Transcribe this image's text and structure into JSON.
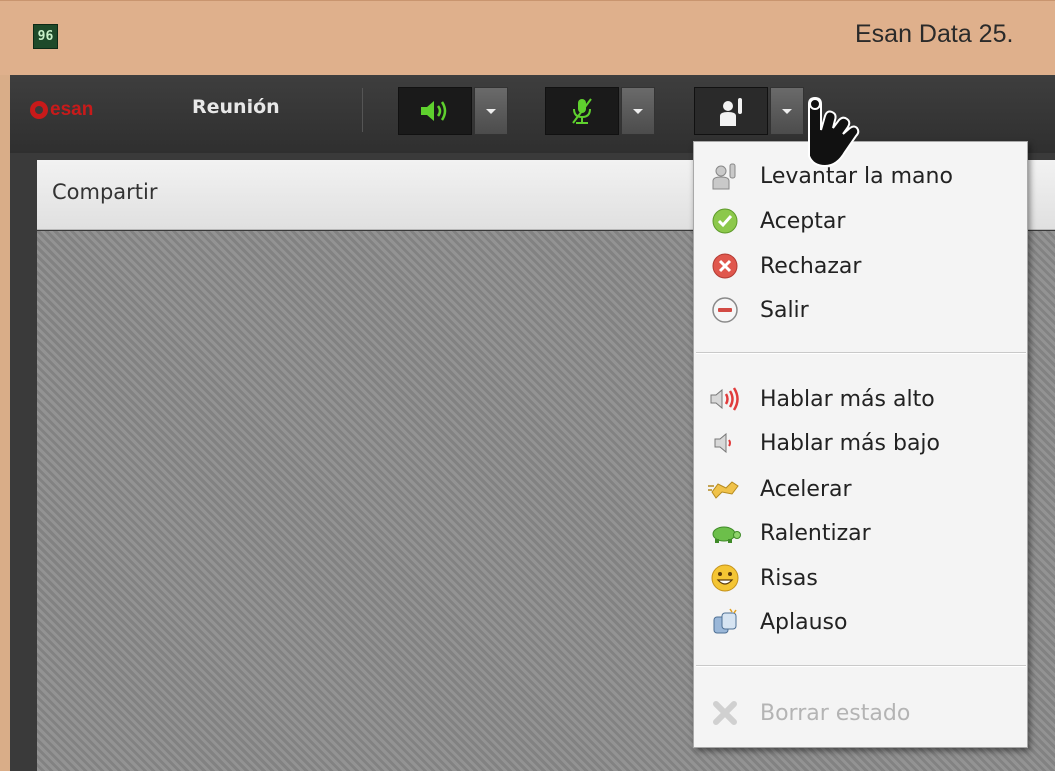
{
  "titlebar": {
    "icon_glyph": "96",
    "title": "Esan Data 25."
  },
  "toolbar": {
    "logo_text": "esan",
    "meeting_label": "Reunión",
    "audio_button_icon": "speaker-icon",
    "mic_button_icon": "mic-muted-icon",
    "status_button_icon": "raise-hand-icon"
  },
  "share_panel": {
    "title": "Compartir"
  },
  "status_menu": {
    "groups": [
      [
        {
          "label": "Levantar la mano",
          "icon": "raise-hand-icon"
        },
        {
          "label": "Aceptar",
          "icon": "check-icon"
        },
        {
          "label": "Rechazar",
          "icon": "reject-icon"
        },
        {
          "label": "Salir",
          "icon": "exit-icon"
        }
      ],
      [
        {
          "label": "Hablar más alto",
          "icon": "speak-louder-icon"
        },
        {
          "label": "Hablar más bajo",
          "icon": "speak-softer-icon"
        },
        {
          "label": "Acelerar",
          "icon": "speed-up-icon"
        },
        {
          "label": "Ralentizar",
          "icon": "slow-down-icon"
        },
        {
          "label": "Risas",
          "icon": "laugh-icon"
        },
        {
          "label": "Aplauso",
          "icon": "applause-icon"
        }
      ],
      [
        {
          "label": "Borrar estado",
          "icon": "clear-status-icon",
          "disabled": true
        }
      ]
    ]
  },
  "colors": {
    "titlebar_bg": "#dfb08c",
    "toolbar_bg": "#3a3a3a",
    "brand_red": "#c81a1a",
    "audio_green": "#5fd12e",
    "menu_bg": "#f4f4f4"
  }
}
